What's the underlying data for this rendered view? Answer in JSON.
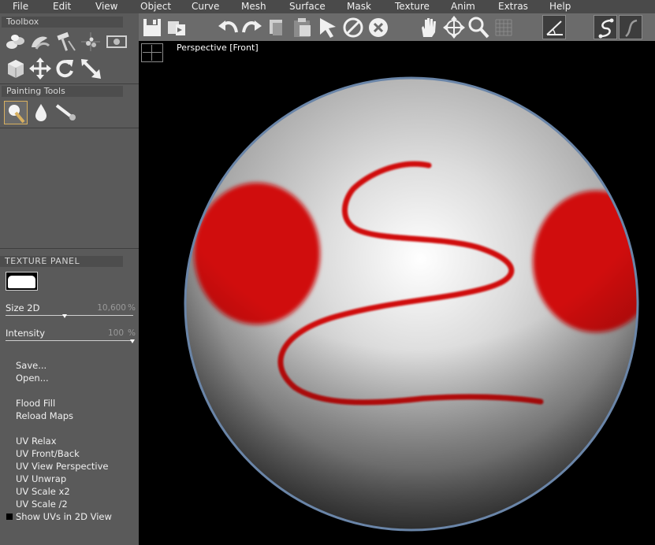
{
  "menu": [
    "File",
    "Edit",
    "View",
    "Object",
    "Curve",
    "Mesh",
    "Surface",
    "Mask",
    "Texture",
    "Anim",
    "Extras",
    "Help"
  ],
  "toolbox": {
    "title": "Toolbox",
    "tools": [
      "paint-brush-3d-icon",
      "smooth-tool-icon",
      "hammer-icon",
      "scatter-tool-icon",
      "camera-icon",
      "cube-icon",
      "move-icon",
      "rotate-icon",
      "scale-icon"
    ]
  },
  "painting_tools": {
    "title": "Painting Tools",
    "tools": [
      "paint-brush-icon",
      "drop-icon",
      "smudge-brush-icon"
    ]
  },
  "texture_panel": {
    "title": "TEXTURE   PANEL",
    "size_label": "Size 2D",
    "size_value": "10,600",
    "size_unit": "%",
    "size_fraction": 0.46,
    "intensity_label": "Intensity",
    "intensity_value": "100",
    "intensity_unit": "%",
    "intensity_fraction": 1.0
  },
  "commands": {
    "save": "Save...",
    "open": "Open...",
    "flood_fill": "Flood Fill",
    "reload_maps": "Reload Maps",
    "uv_relax": "UV Relax",
    "uv_front_back": "UV Front/Back",
    "uv_view_perspective": "UV View Perspective",
    "uv_unwrap": "UV Unwrap",
    "uv_scale_x2": "UV Scale x2",
    "uv_scale_half": "UV Scale /2",
    "show_uvs": "Show UVs in 2D View"
  },
  "viewport": {
    "label": "Perspective [Front]",
    "paint_color": "#d01010",
    "outline_color": "#6a85a8"
  },
  "toolbar_icons": [
    "save-icon",
    "export-icon",
    "undo-icon",
    "redo-icon",
    "copy-icon",
    "paste-icon",
    "select-arrow-icon",
    "no-select-icon",
    "cancel-icon",
    "pan-hand-icon",
    "move-view-icon",
    "zoom-icon",
    "grid-icon",
    "angle-icon",
    "curve-tool-icon",
    "curve-tool-alt-icon"
  ]
}
